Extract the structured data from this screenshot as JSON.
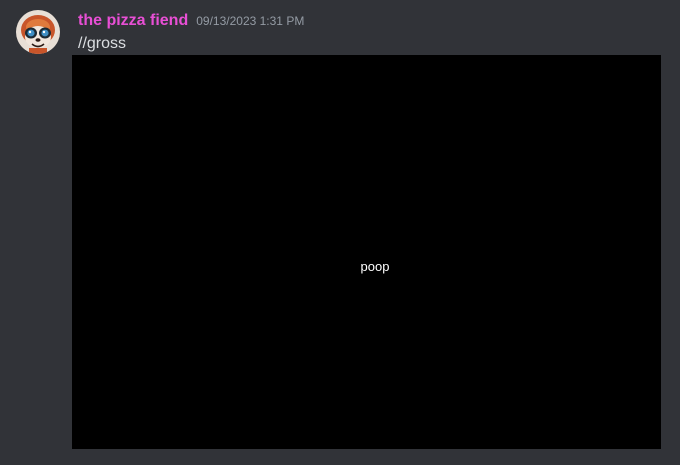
{
  "message": {
    "author": {
      "username": "the pizza fiend",
      "username_color": "#e84fd5",
      "avatar_icon": "cartoon-creature-avatar"
    },
    "timestamp": "09/13/2023 1:31 PM",
    "content": "//gross",
    "attachment": {
      "type": "image",
      "background": "#000000",
      "text": "poop"
    }
  },
  "theme": {
    "background": "#313338",
    "text": "#dbdee1",
    "muted": "#949ba4"
  }
}
